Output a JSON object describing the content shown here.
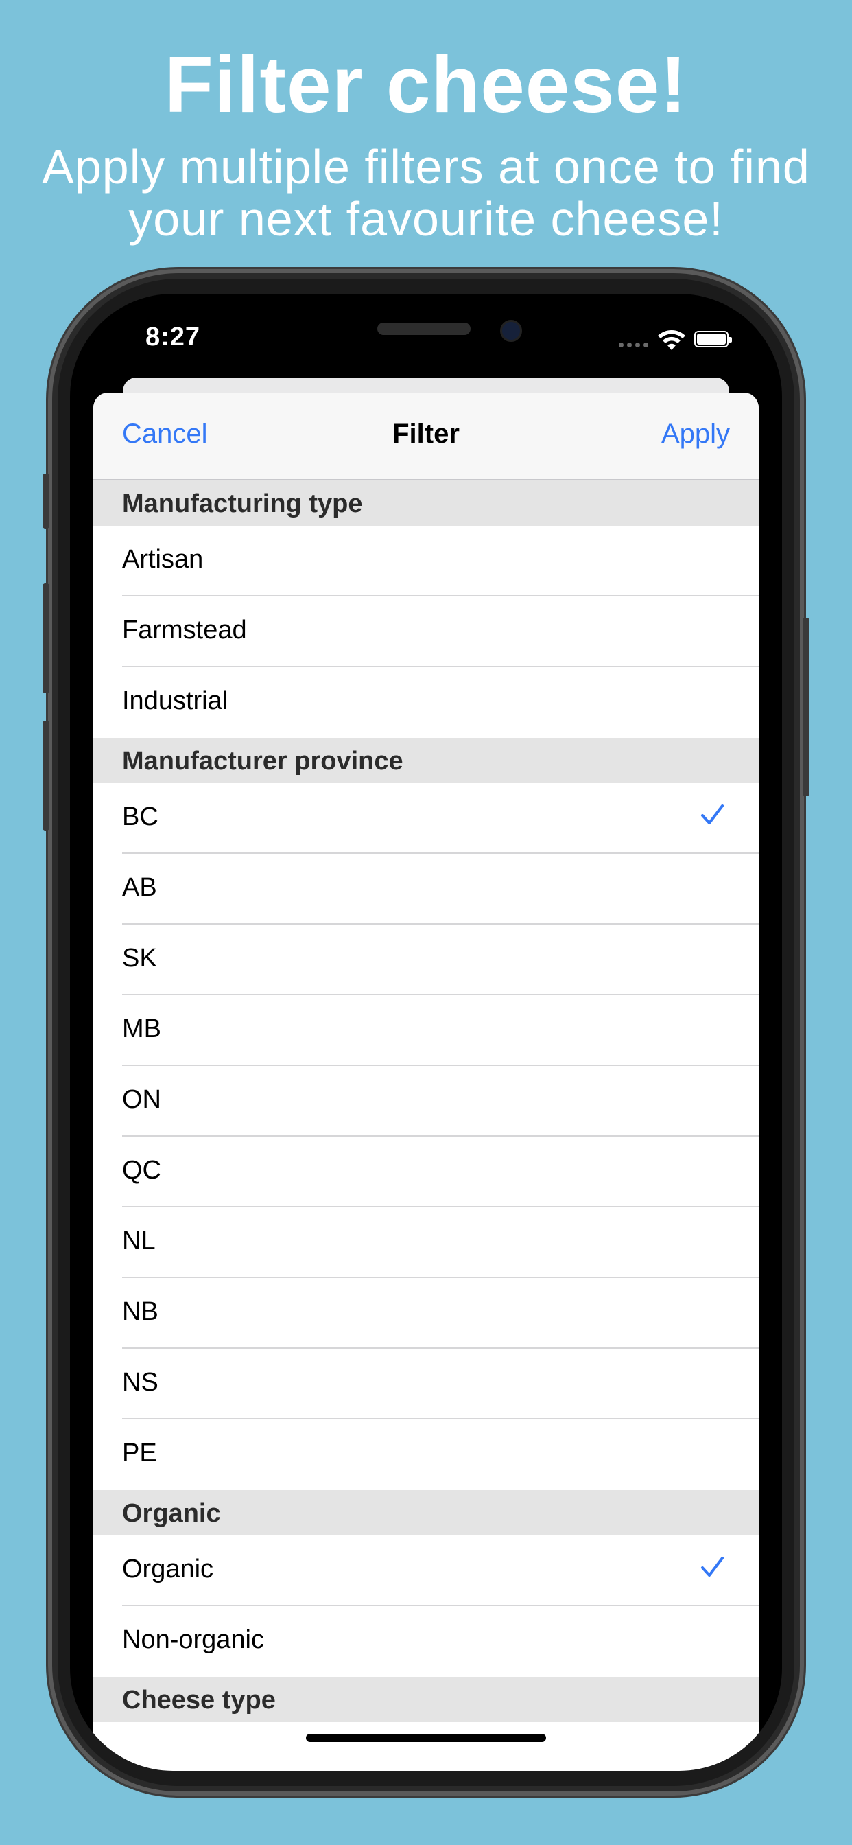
{
  "promo": {
    "title": "Filter cheese!",
    "subtitle": "Apply multiple filters at once to find your next favourite cheese!"
  },
  "status_bar": {
    "time": "8:27",
    "icons": [
      "wifi-icon",
      "battery-icon"
    ]
  },
  "nav": {
    "cancel_label": "Cancel",
    "title": "Filter",
    "apply_label": "Apply"
  },
  "sections": [
    {
      "header": "Manufacturing type",
      "rows": [
        {
          "label": "Artisan",
          "checked": false
        },
        {
          "label": "Farmstead",
          "checked": false
        },
        {
          "label": "Industrial",
          "checked": false
        }
      ]
    },
    {
      "header": "Manufacturer province",
      "rows": [
        {
          "label": "BC",
          "checked": true
        },
        {
          "label": "AB",
          "checked": false
        },
        {
          "label": "SK",
          "checked": false
        },
        {
          "label": "MB",
          "checked": false
        },
        {
          "label": "ON",
          "checked": false
        },
        {
          "label": "QC",
          "checked": false
        },
        {
          "label": "NL",
          "checked": false
        },
        {
          "label": "NB",
          "checked": false
        },
        {
          "label": "NS",
          "checked": false
        },
        {
          "label": "PE",
          "checked": false
        }
      ]
    },
    {
      "header": "Organic",
      "rows": [
        {
          "label": "Organic",
          "checked": true
        },
        {
          "label": "Non-organic",
          "checked": false
        }
      ]
    },
    {
      "header": "Cheese type",
      "rows": []
    }
  ],
  "colors": {
    "background": "#7cc2da",
    "accent": "#3478f6",
    "section_header_bg": "#e4e4e4"
  }
}
